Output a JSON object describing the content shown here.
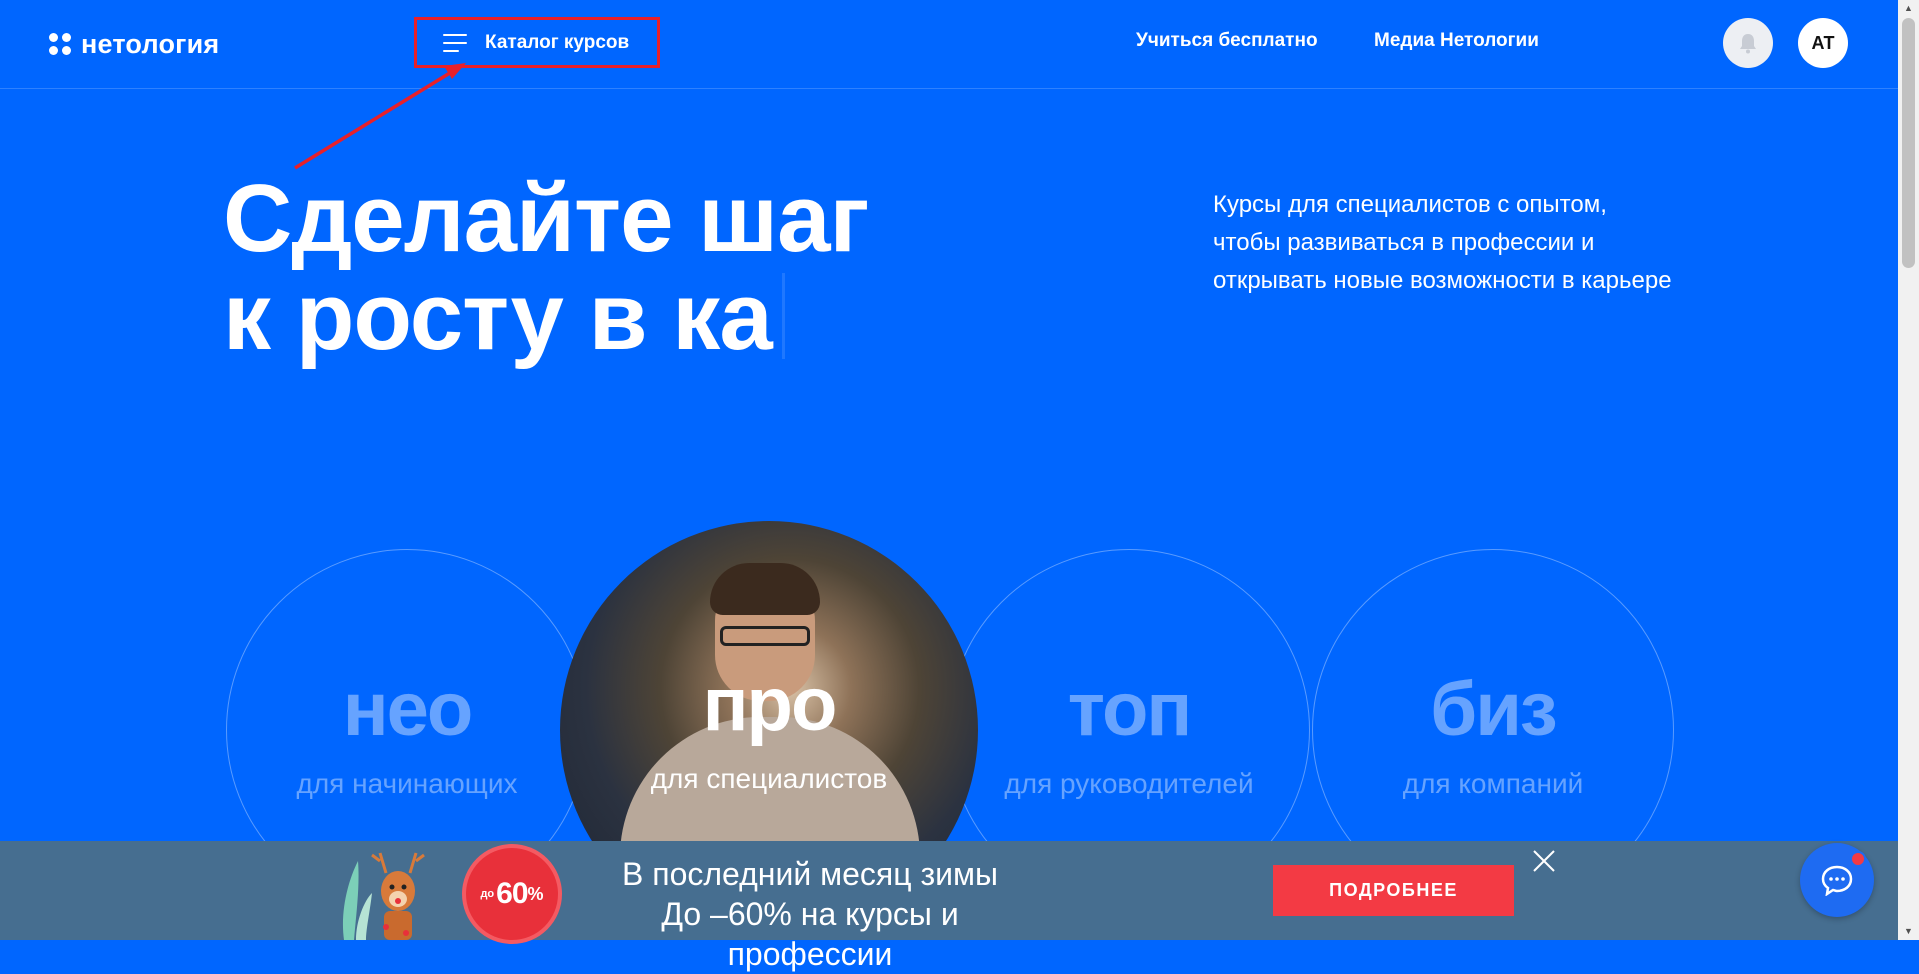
{
  "header": {
    "logo_text": "нетология",
    "catalog_label": "Каталог курсов",
    "nav": [
      {
        "label": "Учиться бесплатно"
      },
      {
        "label": "Медиа Нетологии"
      }
    ],
    "avatar_initials": "АТ"
  },
  "hero": {
    "title": "Сделайте шаг\nк росту в ка",
    "subtitle": "Курсы для специалистов с опытом, чтобы развиваться в профессии и открывать новые возможности в карьере"
  },
  "levels": [
    {
      "name": "нео",
      "desc": "для начинающих"
    },
    {
      "name": "про",
      "desc": "для специалистов"
    },
    {
      "name": "топ",
      "desc": "для руководителей"
    },
    {
      "name": "биз",
      "desc": "для компаний"
    }
  ],
  "banner": {
    "badge_prefix": "до",
    "badge_value": "60",
    "badge_suffix": "%",
    "line1": "В последний месяц зимы",
    "line2": "До –60% на курсы и профессии",
    "button_label": "ПОДРОБНЕЕ"
  },
  "colors": {
    "background": "#0066FF",
    "banner": "#466E90",
    "accent_red": "#F33A44",
    "annotation": "#E8202A"
  }
}
